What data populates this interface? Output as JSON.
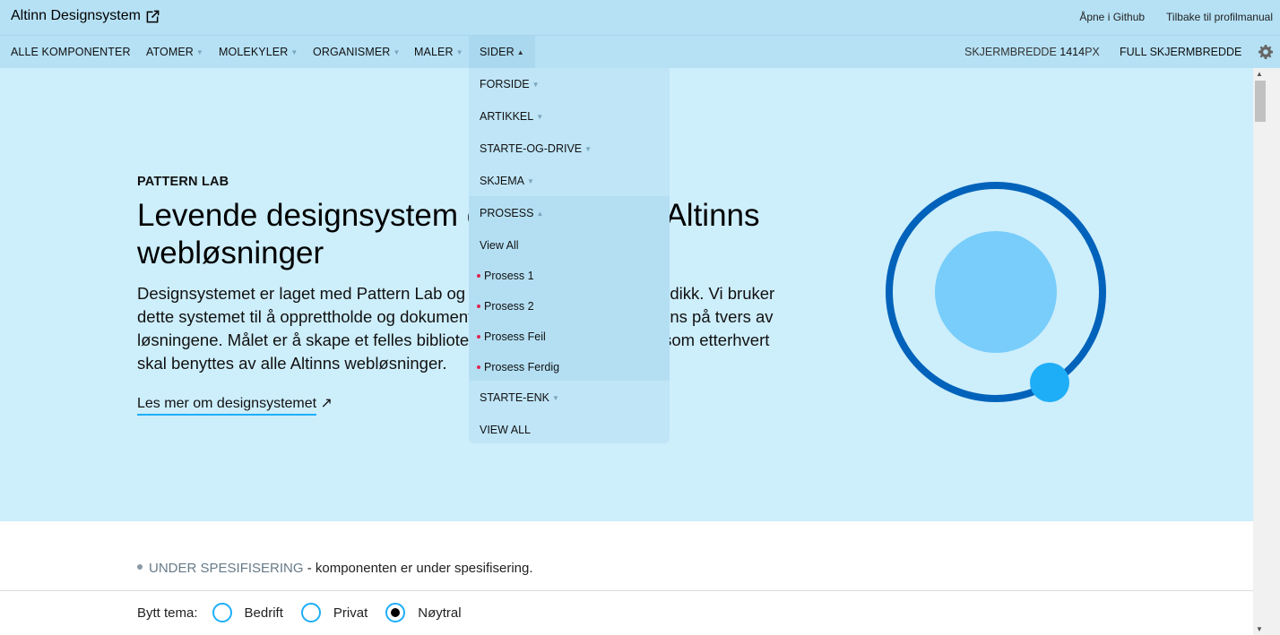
{
  "topbar": {
    "title": "Altinn Designsystem",
    "links": [
      "Åpne i Github",
      "Tilbake til profilmanual"
    ]
  },
  "nav": {
    "items": [
      "ALLE KOMPONENTER",
      "ATOMER",
      "MOLEKYLER",
      "ORGANISMER",
      "MALER",
      "SIDER"
    ],
    "screen_width_label": "SKJERMBREDDE",
    "screen_width_value": "1414",
    "screen_width_unit": "PX",
    "full_width": "FULL SKJERMBREDDE"
  },
  "dropdown": {
    "items": [
      "FORSIDE",
      "ARTIKKEL",
      "STARTE-OG-DRIVE",
      "SKJEMA",
      "PROSESS"
    ],
    "prosess_items": [
      "View All",
      "Prosess 1",
      "Prosess 2",
      "Prosess Feil",
      "Prosess Ferdig"
    ],
    "after_items": [
      "STARTE-ENK",
      "VIEW ALL"
    ]
  },
  "hero": {
    "eyebrow": "PATTERN LAB",
    "heading": "Levende designsystem og verktøy for Altinns webløsninger",
    "lead": "Designsystemet er laget med Pattern Lab og bruker Atomic Design-metodikk. Vi bruker dette systemet til å opprettholde og dokumentere, for å sikre full konsistens på tvers av løsningene. Målet er å skape et felles bibliotek med mønstre og stilsett, som etterhvert skal benyttes av alle Altinns webløsninger.",
    "link": "Les mer om designsystemet",
    "link_arrow": "↗"
  },
  "status": {
    "tag": "UNDER SPESIFISERING",
    "text": " - komponenten er under spesifisering."
  },
  "theme": {
    "label": "Bytt tema:",
    "options": [
      "Bedrift",
      "Privat",
      "Nøytral"
    ],
    "selected": "Nøytral"
  },
  "colors": {
    "nav_bg": "#b6e1f5",
    "hero_bg": "#cdeefb",
    "ring": "#0062ba",
    "circle": "#78cdfa",
    "accent": "#1eaef7"
  }
}
